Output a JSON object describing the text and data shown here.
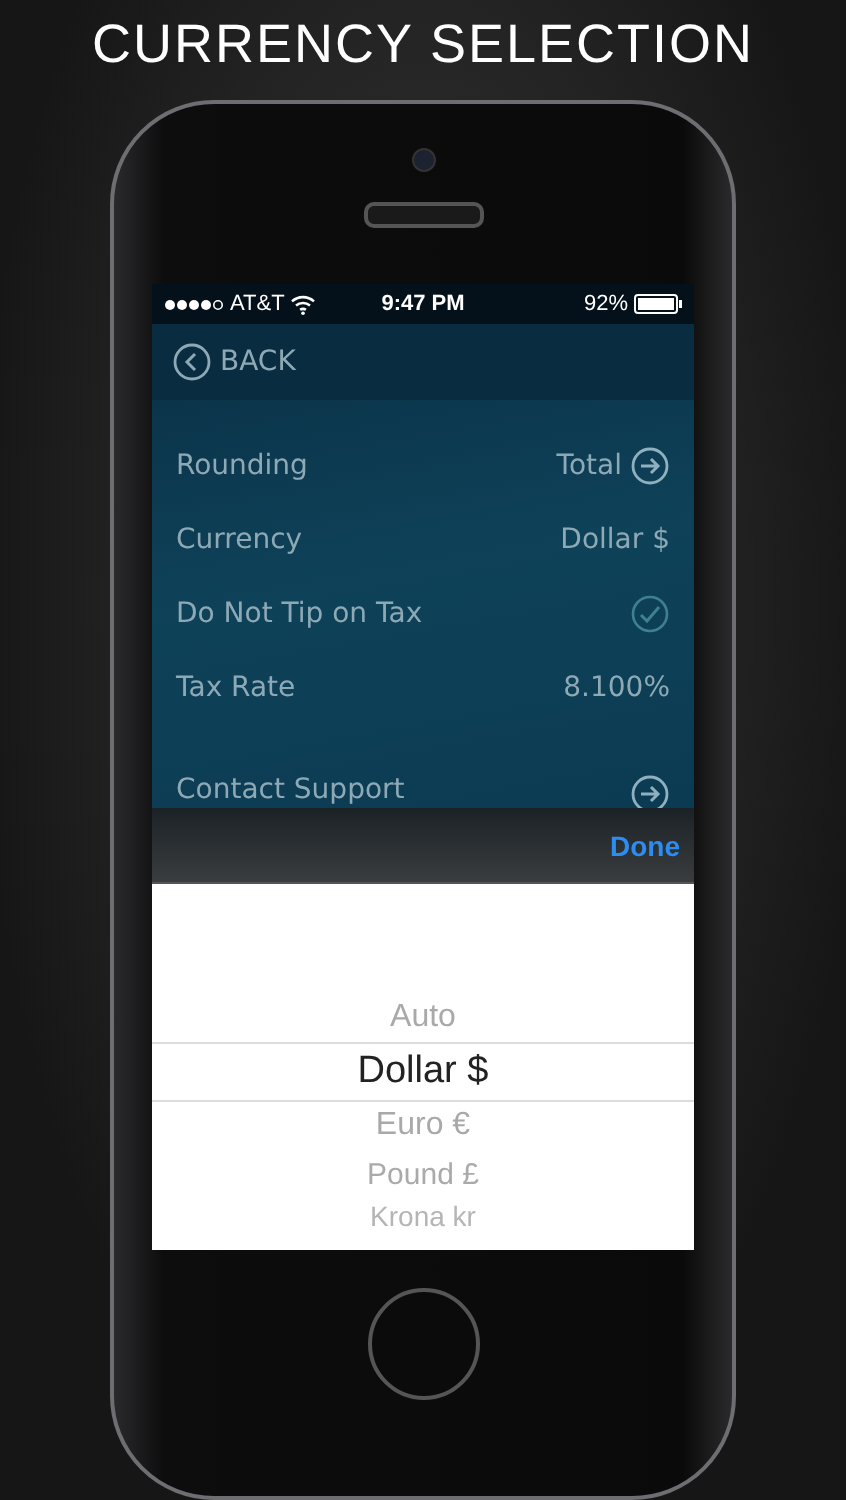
{
  "heading": "CURRENCY SELECTION",
  "status_bar": {
    "carrier": "AT&T",
    "time": "9:47 PM",
    "battery": "92%"
  },
  "nav": {
    "back": "BACK"
  },
  "settings": [
    {
      "kind": "link",
      "label": "Rounding",
      "value": "Total"
    },
    {
      "kind": "value",
      "label": "Currency",
      "value": "Dollar $"
    },
    {
      "kind": "check",
      "label": "Do Not Tip on Tax",
      "checked": true
    },
    {
      "kind": "value",
      "label": "Tax Rate",
      "value": "8.100%"
    },
    {
      "kind": "link",
      "label": "Contact Support"
    }
  ],
  "toolbar": {
    "done": "Done"
  },
  "picker": [
    {
      "label": "Auto",
      "selected": false
    },
    {
      "label": "Dollar $",
      "selected": true
    },
    {
      "label": "Euro €",
      "selected": false
    },
    {
      "label": "Pound £",
      "selected": false
    },
    {
      "label": "Krona kr",
      "selected": false
    }
  ]
}
